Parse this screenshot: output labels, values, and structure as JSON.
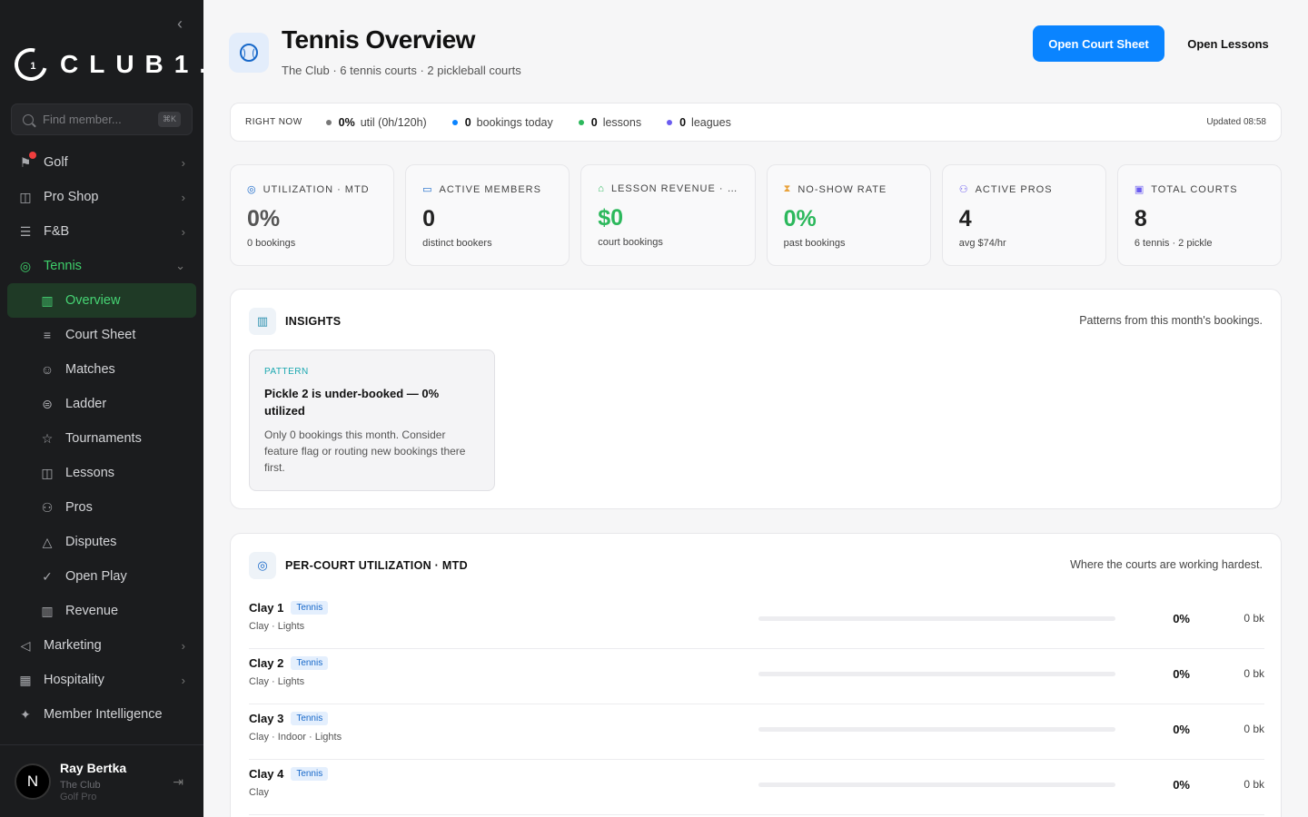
{
  "sidebar": {
    "collapse_icon": "chevron-left-icon",
    "logo_text": "CLUB1.",
    "logo_mark": "1",
    "search": {
      "placeholder": "Find member...",
      "shortcut": "⌘K"
    },
    "items": [
      {
        "label": "Golf",
        "icon": "flag-icon",
        "badge": true
      },
      {
        "label": "Pro Shop",
        "icon": "bag-icon"
      },
      {
        "label": "F&B",
        "icon": "food-icon"
      },
      {
        "label": "Tennis",
        "icon": "tennis-icon",
        "expanded": true
      },
      {
        "label": "Marketing",
        "icon": "megaphone-icon"
      },
      {
        "label": "Hospitality",
        "icon": "building-icon"
      },
      {
        "label": "Member Intelligence",
        "icon": "sparkle-icon"
      }
    ],
    "tennis_sub": [
      {
        "label": "Overview",
        "icon": "chart-icon"
      },
      {
        "label": "Court Sheet",
        "icon": "list-icon"
      },
      {
        "label": "Matches",
        "icon": "smile-icon"
      },
      {
        "label": "Ladder",
        "icon": "layers-icon"
      },
      {
        "label": "Tournaments",
        "icon": "star-icon"
      },
      {
        "label": "Lessons",
        "icon": "book-icon"
      },
      {
        "label": "Pros",
        "icon": "users-icon"
      },
      {
        "label": "Disputes",
        "icon": "warning-icon"
      },
      {
        "label": "Open Play",
        "icon": "check-circle-icon"
      },
      {
        "label": "Revenue",
        "icon": "bar-chart-icon"
      }
    ],
    "user": {
      "initial": "N",
      "name": "Ray Bertka",
      "club": "The Club",
      "role": "Golf Pro"
    }
  },
  "header": {
    "title": "Tennis Overview",
    "subtitle": "The Club · 6 tennis courts · 2 pickleball courts",
    "primary_button": "Open Court Sheet",
    "secondary_button": "Open Lessons"
  },
  "right_now": {
    "label": "RIGHT NOW",
    "items": [
      {
        "value": "0%",
        "text": "util (0h/120h)",
        "color": "#777777"
      },
      {
        "value": "0",
        "text": "bookings today",
        "color": "#0a84ff"
      },
      {
        "value": "0",
        "text": "lessons",
        "color": "#2cb85c"
      },
      {
        "value": "0",
        "text": "leagues",
        "color": "#6b5cf0"
      }
    ],
    "updated": "Updated 08:58"
  },
  "stats": [
    {
      "label": "UTILIZATION · MTD",
      "value": "0%",
      "note": "0 bookings",
      "icon": "ball-icon",
      "icon_color": "#1768c9",
      "style": "gray"
    },
    {
      "label": "ACTIVE MEMBERS",
      "value": "0",
      "note": "distinct bookers",
      "icon": "card-icon",
      "icon_color": "#1768c9",
      "style": ""
    },
    {
      "label": "LESSON REVENUE · …",
      "value": "$0",
      "note": "court bookings",
      "icon": "graduation-icon",
      "icon_color": "#2cb85c",
      "style": "green"
    },
    {
      "label": "NO-SHOW RATE",
      "value": "0%",
      "note": "past bookings",
      "icon": "hourglass-icon",
      "icon_color": "#e9a23b",
      "style": "green"
    },
    {
      "label": "ACTIVE PROS",
      "value": "4",
      "note": "avg $74/hr",
      "icon": "user-icon",
      "icon_color": "#6b5cf0",
      "style": ""
    },
    {
      "label": "TOTAL COURTS",
      "value": "8",
      "note": "6 tennis · 2 pickle",
      "icon": "calendar-icon",
      "icon_color": "#6b5cf0",
      "style": ""
    }
  ],
  "insights": {
    "title": "INSIGHTS",
    "subtitle": "Patterns from this month's bookings.",
    "card": {
      "tag": "PATTERN",
      "title": "Pickle 2 is under-booked — 0% utilized",
      "body": "Only 0 bookings this month. Consider feature flag or routing new bookings there first."
    }
  },
  "courts": {
    "title": "PER-COURT UTILIZATION · MTD",
    "subtitle": "Where the courts are working hardest.",
    "rows": [
      {
        "name": "Clay 1",
        "tag": "Tennis",
        "meta": "Clay · Lights",
        "util": 0,
        "pct": "0%",
        "bookings": "0 bk"
      },
      {
        "name": "Clay 2",
        "tag": "Tennis",
        "meta": "Clay · Lights",
        "util": 0,
        "pct": "0%",
        "bookings": "0 bk"
      },
      {
        "name": "Clay 3",
        "tag": "Tennis",
        "meta": "Clay · Indoor · Lights",
        "util": 0,
        "pct": "0%",
        "bookings": "0 bk"
      },
      {
        "name": "Clay 4",
        "tag": "Tennis",
        "meta": "Clay",
        "util": 0,
        "pct": "0%",
        "bookings": "0 bk"
      }
    ]
  }
}
